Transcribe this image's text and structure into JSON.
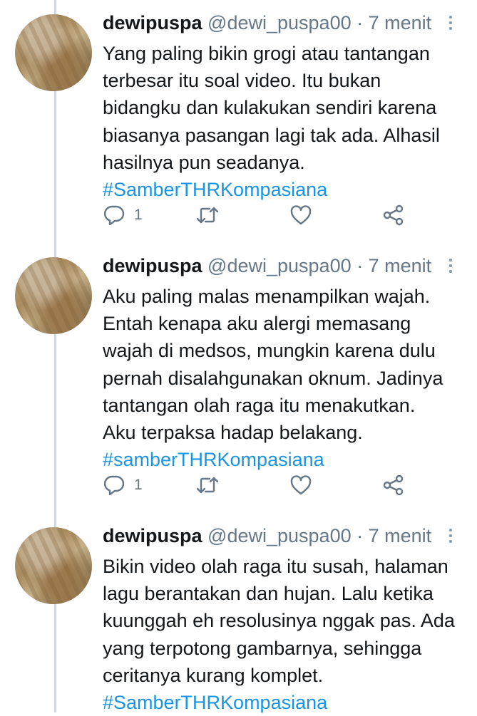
{
  "tweets": [
    {
      "name": "dewipuspa",
      "handle": "@dewi_puspa00",
      "time": "· 7 menit",
      "lines": [
        "Yang paling bikin grogi atau tantangan",
        "terbesar itu soal video. Itu bukan",
        "bidangku dan kulakukan sendiri karena",
        "biasanya pasangan lagi tak ada. Alhasil",
        "hasilnya pun seadanya."
      ],
      "hashtag": "#SamberTHRKompasiana",
      "reply_count": "1"
    },
    {
      "name": "dewipuspa",
      "handle": "@dewi_puspa00",
      "time": "· 7 menit",
      "lines": [
        "Aku paling malas menampilkan wajah.",
        "Entah kenapa aku alergi memasang",
        "wajah di medsos, mungkin karena dulu",
        "pernah disalahgunakan oknum. Jadinya",
        "tantangan olah raga itu menakutkan.",
        "Aku terpaksa hadap belakang."
      ],
      "hashtag": "#samberTHRKompasiana",
      "reply_count": "1"
    },
    {
      "name": "dewipuspa",
      "handle": "@dewi_puspa00",
      "time": "· 7 menit",
      "lines": [
        "Bikin video olah raga itu susah, halaman",
        "lagu berantakan dan hujan. Lalu ketika",
        "kuunggah eh resolusinya nggak pas. Ada",
        "yang terpotong gambarnya, sehingga",
        "ceritanya kurang komplet."
      ],
      "hashtag": "#SamberTHRKompasiana"
    }
  ],
  "icons": {
    "reply": "reply-icon",
    "retweet": "retweet-icon",
    "like": "heart-icon",
    "share": "share-icon",
    "more": "more-options-icon"
  },
  "colors": {
    "link": "#1b95e0",
    "secondary": "#657786",
    "icon": "#657786",
    "thread_line": "#cfd9de"
  }
}
